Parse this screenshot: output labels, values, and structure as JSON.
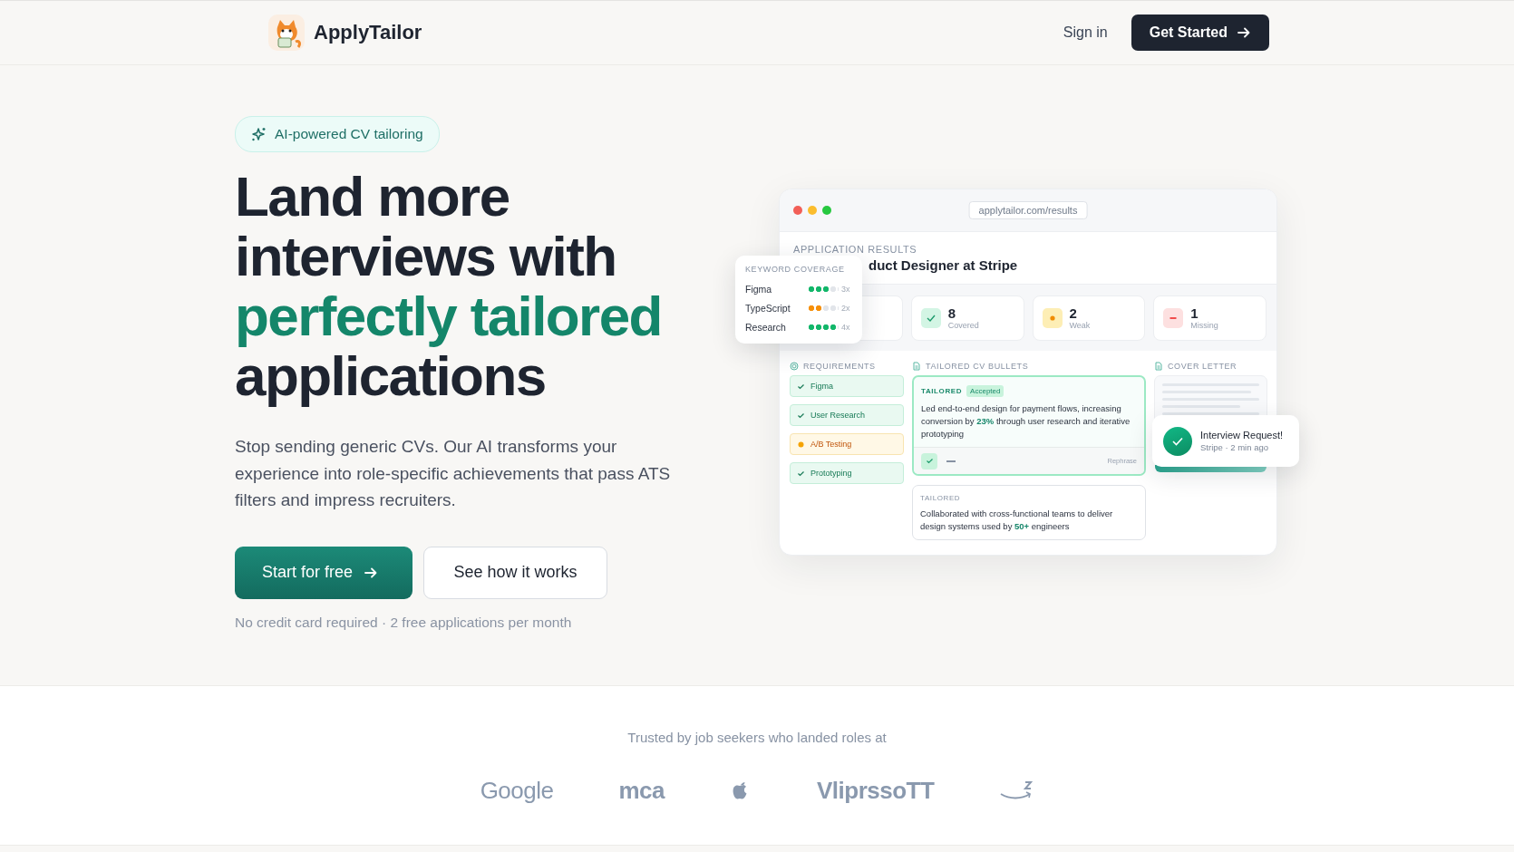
{
  "header": {
    "brand": "ApplyTailor",
    "sign_in": "Sign in",
    "cta": "Get Started"
  },
  "hero": {
    "badge": "AI-powered CV tailoring",
    "heading": [
      {
        "text": "Land more",
        "accent": false
      },
      {
        "text": "interviews with",
        "accent": false
      },
      {
        "text": "perfectly tailored",
        "accent": true
      },
      {
        "text": "applications",
        "accent": false
      }
    ],
    "description": "Stop sending generic CVs. Our AI transforms your experience into role-specific achievements that pass ATS filters and impress recruiters.",
    "buttons": [
      {
        "label": "Start for free",
        "kind": "primary"
      },
      {
        "label": "See how it works",
        "kind": "secondary"
      }
    ],
    "note": "No credit card required · 2 free applications per month"
  },
  "mockup": {
    "url": "applytailor.com/results",
    "section_label": "APPLICATION RESULTS",
    "title": "duct Designer at Stripe",
    "stats": [
      {
        "kind": "hidden"
      },
      {
        "kind": "covered",
        "value": "8",
        "label": "Covered"
      },
      {
        "kind": "weak",
        "value": "2",
        "label": "Weak"
      },
      {
        "kind": "missing",
        "value": "1",
        "label": "Missing"
      }
    ],
    "requirements": {
      "label": "REQUIREMENTS",
      "items": [
        {
          "name": "Figma",
          "kind": "met"
        },
        {
          "name": "User Research",
          "kind": "met"
        },
        {
          "name": "A/B Testing",
          "kind": "weak"
        },
        {
          "name": "Prototyping",
          "kind": "met"
        }
      ]
    },
    "bullets": {
      "label": "TAILORED CV BULLETS",
      "items": [
        {
          "tag": "TAILORED",
          "status": "Accepted",
          "highlighted": true,
          "text": "Led end-to-end design for payment flows, increasing conversion by **23%** through user research and iterative prototyping",
          "action": "Rephrase"
        },
        {
          "tag": "TAILORED",
          "highlighted": false,
          "text": "Collaborated with cross-functional teams to deliver design systems used by **50+** engineers"
        }
      ]
    },
    "cover_letter": {
      "label": "COVER LETTER"
    },
    "keyword_coverage": {
      "title": "KEYWORD COVERAGE",
      "items": [
        {
          "name": "Figma",
          "level": 0.75,
          "color": "#12b76a",
          "count": "3x"
        },
        {
          "name": "TypeScript",
          "level": 0.5,
          "color": "#f79009",
          "count": "2x"
        },
        {
          "name": "Research",
          "level": 1,
          "color": "#12b76a",
          "count": "4x"
        }
      ]
    },
    "notification": {
      "title": "Interview Request!",
      "subtitle": "Stripe · 2 min ago"
    }
  },
  "trusted": {
    "caption": "Trusted by job seekers who landed roles at",
    "logos": [
      {
        "kind": "wordmark",
        "text": "Google"
      },
      {
        "kind": "wordmark",
        "text": "mca"
      },
      {
        "kind": "fruit"
      },
      {
        "kind": "wordmark",
        "text": "VliprssoTT"
      },
      {
        "kind": "smile"
      }
    ]
  }
}
